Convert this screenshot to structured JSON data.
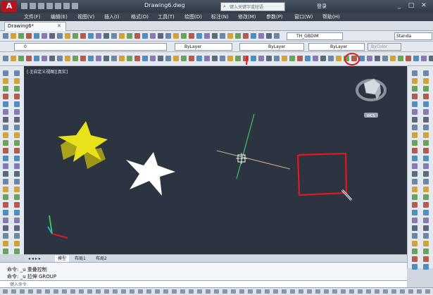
{
  "window": {
    "app_logo": "A",
    "title": "Drawing6.dwg",
    "search_placeholder": "键入关键字或短语",
    "login_label": "登录",
    "controls": [
      "_",
      "□",
      "✕"
    ]
  },
  "menu": [
    "文件(F)",
    "编辑(E)",
    "视图(V)",
    "插入(I)",
    "格式(O)",
    "工具(T)",
    "绘图(D)",
    "标注(N)",
    "修改(M)",
    "参数(P)",
    "窗口(W)",
    "帮助(H)"
  ],
  "tabs": [
    {
      "label": "Drawing6*"
    }
  ],
  "toolbar_row2": {
    "dimstyle_value": "TH_GBDIM",
    "standard_value": "Standa"
  },
  "properties_bar": {
    "layer_value": "0",
    "color_value": "ByLayer",
    "linetype_value": "ByLayer",
    "lineweight_value": "ByLayer",
    "plotstyle_value": "ByColor"
  },
  "viewport": {
    "label": "[-][自定义视图][真实]",
    "viewcube_label": "WCS"
  },
  "layout_tabs": [
    "模型",
    "布局1",
    "布局2"
  ],
  "command": {
    "history": [
      "命令:  _u 重叠控制",
      "命令:  _u 拉伸 GROUP"
    ],
    "input_placeholder": "键入命令"
  },
  "colors": {
    "canvas_bg": "#2b3440",
    "star_3d": "#e9e21a",
    "star_2d": "#ffffff",
    "annotation_red": "#e1191e",
    "axis_green": "#3fbf5a"
  },
  "icons": [
    "application-menu-icon",
    "new-icon",
    "open-icon",
    "save-icon",
    "undo-icon",
    "redo-icon",
    "search-icon",
    "viewcube-icon",
    "ucs-icon",
    "crosshair-cursor"
  ]
}
